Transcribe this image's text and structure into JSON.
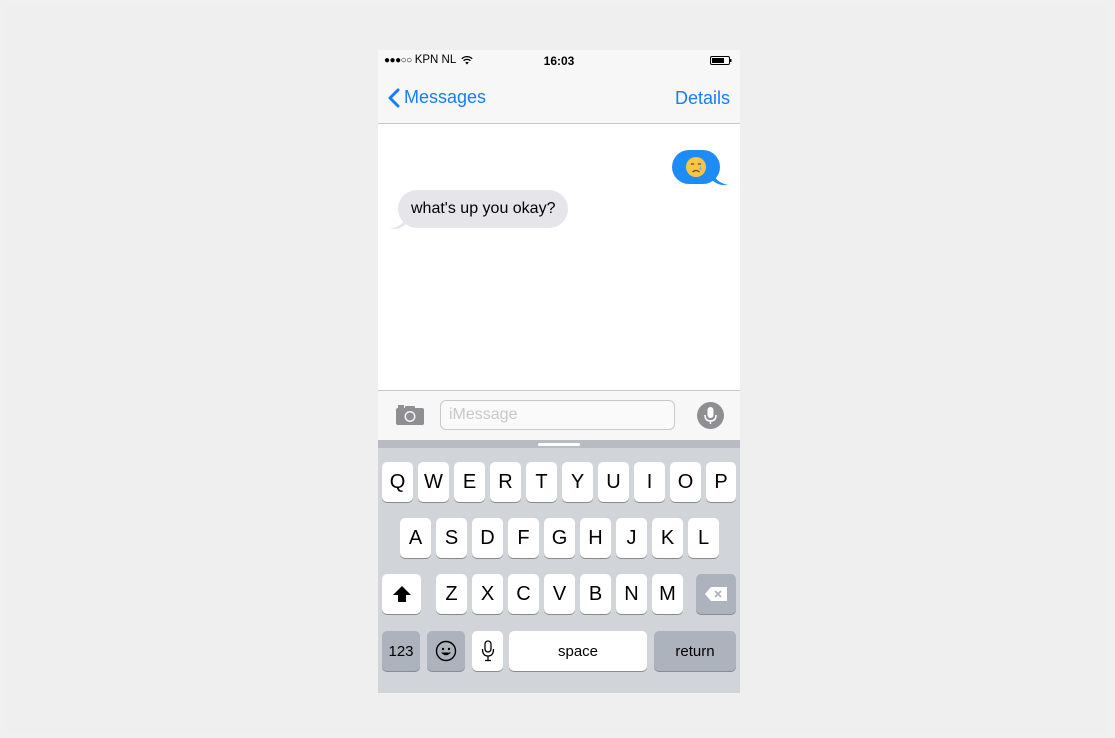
{
  "status_bar": {
    "carrier": "KPN NL",
    "signal_dots": "●●●○○",
    "time": "16:03"
  },
  "nav": {
    "back_label": "Messages",
    "details_label": "Details"
  },
  "conversation": {
    "outgoing": [
      {
        "content": "crying-face-emoji"
      }
    ],
    "incoming": [
      {
        "text": "what's up you okay?"
      }
    ]
  },
  "input": {
    "placeholder": "iMessage",
    "value": ""
  },
  "keyboard": {
    "row1": [
      "Q",
      "W",
      "E",
      "R",
      "T",
      "Y",
      "U",
      "I",
      "O",
      "P"
    ],
    "row2": [
      "A",
      "S",
      "D",
      "F",
      "G",
      "H",
      "J",
      "K",
      "L"
    ],
    "row3": [
      "Z",
      "X",
      "C",
      "V",
      "B",
      "N",
      "M"
    ],
    "numbers_label": "123",
    "space_label": "space",
    "return_label": "return"
  },
  "colors": {
    "accent": "#147efb",
    "outgoing_bubble": "#1d8cf8",
    "incoming_bubble": "#e5e5ea",
    "keyboard_bg": "#d1d4d9"
  },
  "icons": [
    "wifi-icon",
    "battery-icon",
    "back-chevron-icon",
    "camera-icon",
    "microphone-icon",
    "shift-icon",
    "backspace-icon",
    "emoji-icon",
    "dictation-icon"
  ]
}
